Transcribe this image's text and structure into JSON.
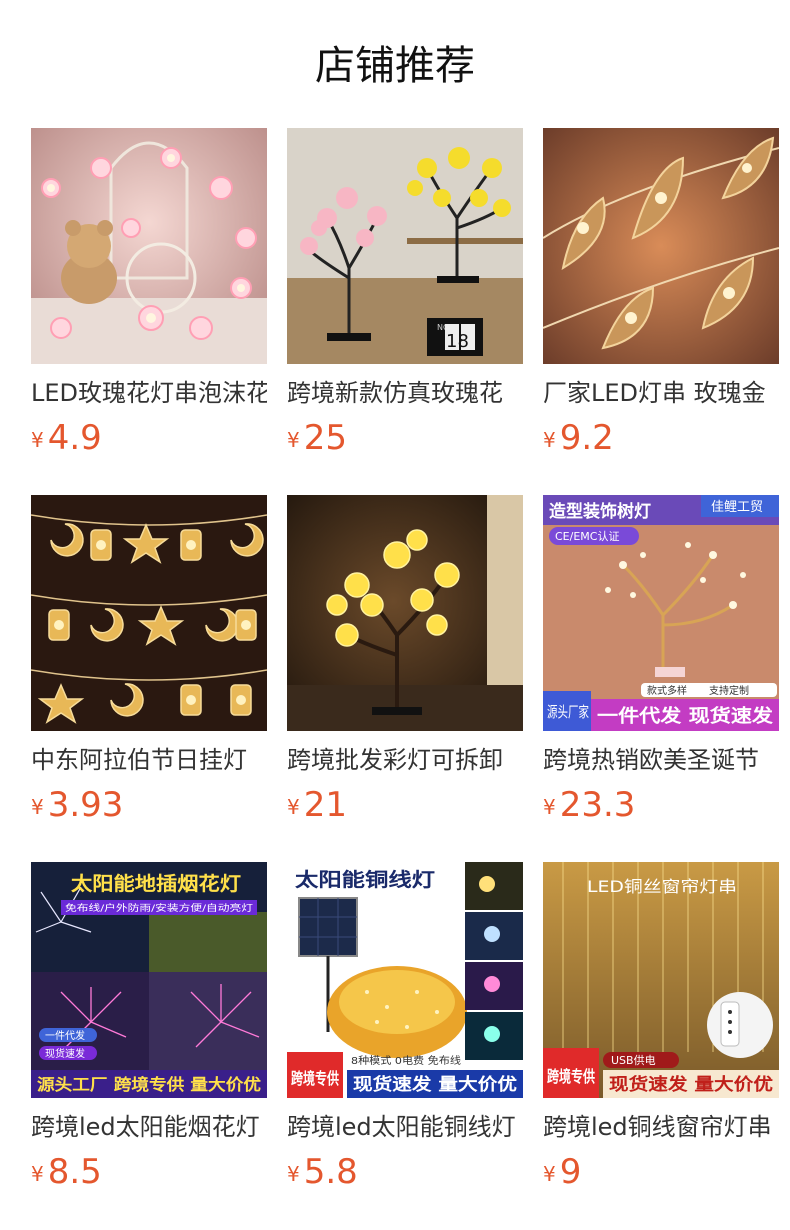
{
  "page_title": "店铺推荐",
  "colors": {
    "price": "#e4572e",
    "title": "#111111"
  },
  "products": [
    {
      "name": "LED玫瑰花灯串泡沫花",
      "currency": "¥",
      "price": "4.9",
      "image": "rose-string-light-photo"
    },
    {
      "name": "跨境新款仿真玫瑰花",
      "currency": "¥",
      "price": "25",
      "image": "rose-tree-lamp-photo",
      "overlay": {
        "clock_month": "NOV",
        "clock_day": "18"
      }
    },
    {
      "name": "厂家LED灯串 玫瑰金",
      "currency": "¥",
      "price": "9.2",
      "image": "gold-leaf-string-light-photo"
    },
    {
      "name": "中东阿拉伯节日挂灯",
      "currency": "¥",
      "price": "3.93",
      "image": "moon-star-lantern-string-photo"
    },
    {
      "name": "跨境批发彩灯可拆卸",
      "currency": "¥",
      "price": "21",
      "image": "yellow-rose-tree-lamp-photo"
    },
    {
      "name": "跨境热销欧美圣诞节",
      "currency": "¥",
      "price": "23.3",
      "image": "decorative-tree-lamp-ad",
      "overlay": {
        "headline": "造型装饰树灯",
        "brand": "佳鲤工贸",
        "cert": "CE/EMC认证",
        "tag1": "款式多样",
        "tag2": "支持定制",
        "corner": "源头厂家",
        "banner": "一件代发 现货速发"
      }
    },
    {
      "name": "跨境led太阳能烟花灯",
      "currency": "¥",
      "price": "8.5",
      "image": "solar-firework-lamp-ad",
      "overlay": {
        "headline": "太阳能地插烟花灯",
        "sub": "免布线/户外防雨/安装方便/自动亮灯",
        "tag1": "一件代发",
        "tag2": "现货速发",
        "banner": "源头工厂 跨境专供 量大价优"
      }
    },
    {
      "name": "跨境led太阳能铜线灯",
      "currency": "¥",
      "price": "5.8",
      "image": "solar-copper-wire-light-ad",
      "overlay": {
        "headline": "太阳能铜线灯",
        "corner": "跨境专供",
        "sub": "8种模式 0电费 免布线",
        "banner": "现货速发 量大价优"
      }
    },
    {
      "name": "跨境led铜线窗帘灯串",
      "currency": "¥",
      "price": "9",
      "image": "curtain-light-ad",
      "overlay": {
        "headline": "LED铜丝窗帘灯串",
        "corner": "跨境专供",
        "usb": "USB供电",
        "banner": "现货速发 量大价优"
      }
    }
  ]
}
